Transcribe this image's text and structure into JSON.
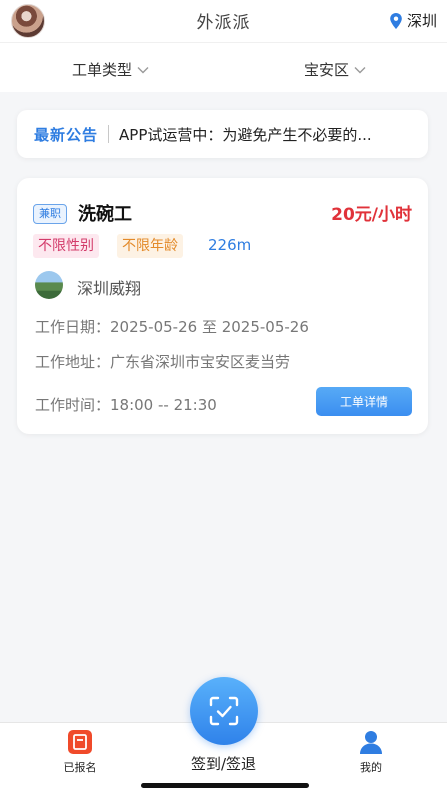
{
  "header": {
    "title": "外派派",
    "city": "深圳"
  },
  "filters": {
    "type_label": "工单类型",
    "district_label": "宝安区"
  },
  "notice": {
    "label": "最新公告",
    "text": "APP试运营中：为避免产生不必要的..."
  },
  "job": {
    "type_badge": "兼职",
    "title": "洗碗工",
    "salary": "20元/小时",
    "tags": [
      "不限性别",
      "不限年龄"
    ],
    "distance": "226m",
    "company": "深圳威翔",
    "work_date": "工作日期：2025-05-26 至 2025-05-26",
    "work_address": "工作地址：广东省深圳市宝安区麦当劳",
    "work_time": "工作时间：18:00 -- 21:30",
    "detail_button": "工单详情"
  },
  "bottom_nav": {
    "registered": "已报名",
    "checkin": "签到/签退",
    "mine": "我的"
  },
  "colors": {
    "accent": "#2f7de1",
    "salary": "#e0323a",
    "gender_tag": "#d33b6a",
    "age_tag": "#e38a2a",
    "nav_registered": "#f04a2a"
  },
  "icons": {
    "location": "location-pin-icon",
    "chevron": "chevron-down-icon",
    "registered": "document-icon",
    "checkin": "scan-check-icon",
    "mine": "person-icon"
  }
}
